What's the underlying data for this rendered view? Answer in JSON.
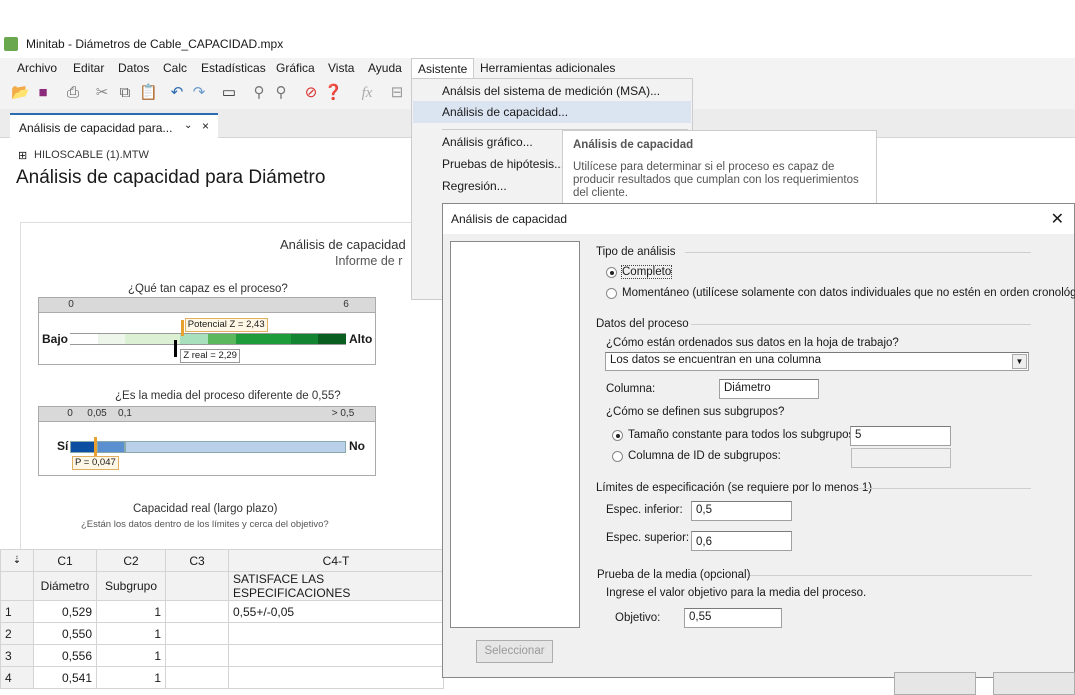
{
  "app": {
    "title": "Minitab - Diámetros de Cable_CAPACIDAD.mpx"
  },
  "menubar": [
    "Archivo",
    "Editar",
    "Datos",
    "Calc",
    "Estadísticas",
    "Gráfica",
    "Vista",
    "Ayuda",
    "Asistente",
    "Herramientas adicionales"
  ],
  "tab": {
    "label": "Análisis de capacidad para...",
    "chevron": "⌄",
    "close": "×"
  },
  "content": {
    "worksheet": "HILOSCABLE (1).MTW",
    "title": "Análisis de capacidad para Diámetro"
  },
  "report": {
    "title": "Análisis de capacidad",
    "subtitle": "Informe de r",
    "gauge1": {
      "question": "¿Qué tan capaz es el proceso?",
      "low": "Bajo",
      "high": "Alto",
      "min": 0,
      "max": 6,
      "min_label": "0",
      "max_label": "6",
      "segments": [
        0,
        0.6,
        1.2,
        2.4,
        3,
        3.6,
        4.8,
        5.4,
        6
      ],
      "colors": [
        "#ffffff",
        "#eef6ec",
        "#dcf0d4",
        "#a8dfbd",
        "#5cb85c",
        "#1e9b3a",
        "#138532",
        "#0a5e20"
      ],
      "potential_label": "Potencial Z = 2,43",
      "potential": 2.43,
      "actual_label": "Z real = 2,29",
      "actual": 2.29
    },
    "gauge2": {
      "question": "¿Es la media del proceso diferente de 0,55?",
      "yes": "Sí",
      "no": "No",
      "ticks": [
        "0",
        "0,05",
        "0,1",
        "> 0,5"
      ],
      "p_label": "P = 0,047",
      "p": 0.047
    },
    "section": "Capacidad real (largo plazo)",
    "section_sub": "¿Están los datos dentro de los límites y cerca del objetivo?"
  },
  "worksheet": {
    "cols": [
      "C1",
      "C2",
      "C3",
      "C4-T"
    ],
    "names": [
      "Diámetro",
      "Subgrupo",
      "",
      "SATISFACE LAS ESPECIFICACIONES"
    ],
    "rows": [
      [
        "1",
        "0,529",
        "1",
        "",
        "0,55+/-0,05"
      ],
      [
        "2",
        "0,550",
        "1",
        "",
        ""
      ],
      [
        "3",
        "0,556",
        "1",
        "",
        ""
      ],
      [
        "4",
        "0,541",
        "1",
        "",
        ""
      ]
    ]
  },
  "menu": {
    "items": [
      "Análsis del sistema de medición (MSA)...",
      "Análisis de capacidad...",
      "Análisis gráfico...",
      "Pruebas de hipótesis...",
      "Regresión..."
    ]
  },
  "tooltip": {
    "title": "Análisis de capacidad",
    "body": "Utilícese para determinar si el proceso es capaz de producir resultados que cumplan con los requerimientos del cliente."
  },
  "dialog": {
    "title": "Análisis de capacidad",
    "select_button": "Seleccionar",
    "tipo": "Tipo de análisis",
    "completo": "Completo",
    "momentaneo": "Momentáneo (utilícese solamente con datos individuales que no estén en orden cronológico)",
    "datos": "Datos del proceso",
    "q1": "¿Cómo están ordenados sus datos en la hoja de trabajo?",
    "arrangement": "Los datos se encuentran en una columna",
    "columna_label": "Columna:",
    "columna": "Diámetro",
    "q2": "¿Cómo se definen sus subgrupos?",
    "tam_label": "Tamaño constante para todos los subgrupos:",
    "tam": "5",
    "colid_label": "Columna de ID de subgrupos:",
    "colid": "",
    "limites": "Límites de especificación (se requiere por lo menos 1)",
    "inf_label": "Espec. inferior:",
    "inf": "0,5",
    "sup_label": "Espec. superior:",
    "sup": "0,6",
    "prueba": "Prueba de la media (opcional)",
    "ingrese": "Ingrese el valor objetivo para la media del proceso.",
    "obj_label": "Objetivo:",
    "obj": "0,55"
  }
}
